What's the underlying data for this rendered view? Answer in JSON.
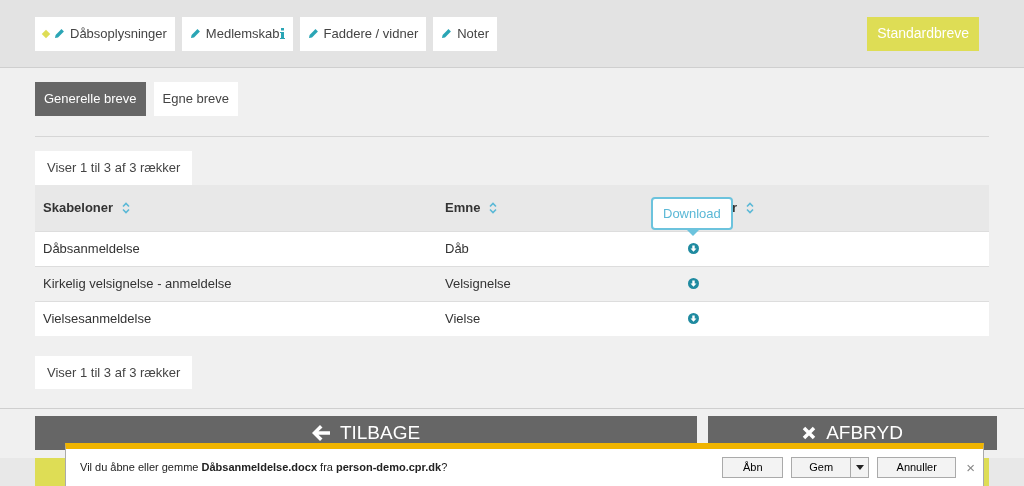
{
  "top_tabs": [
    {
      "label": "Dåbsoplysninger",
      "marked": true,
      "info": false
    },
    {
      "label": "Medlemskab",
      "marked": false,
      "info": true
    },
    {
      "label": "Faddere / vidner",
      "marked": false,
      "info": false
    },
    {
      "label": "Noter",
      "marked": false,
      "info": false
    }
  ],
  "standard_button": "Standardbreve",
  "sub_tabs": [
    {
      "label": "Generelle breve",
      "selected": true
    },
    {
      "label": "Egne breve",
      "selected": false
    }
  ],
  "info_top": "Viser 1 til 3 af 3 rækker",
  "table": {
    "columns": [
      "Skabeloner",
      "Emne",
      "r"
    ],
    "rows": [
      {
        "template": "Dåbsanmeldelse",
        "subject": "Dåb"
      },
      {
        "template": "Kirkelig velsignelse - anmeldelse",
        "subject": "Velsignelse"
      },
      {
        "template": "Vielsesanmeldelse",
        "subject": "Vielse"
      }
    ]
  },
  "tooltip": "Download",
  "info_bottom": "Viser 1 til 3 af 3 rækker",
  "back_button": "TILBAGE",
  "cancel_button": "AFBRYD",
  "download_bar": {
    "message": "Vil du åbne eller gemme **Dåbsanmeldelse.docx** fra **person-demo.cpr.dk**?",
    "open": "Åbn",
    "save": "Gem",
    "cancel": "Annuller",
    "close": "×"
  }
}
